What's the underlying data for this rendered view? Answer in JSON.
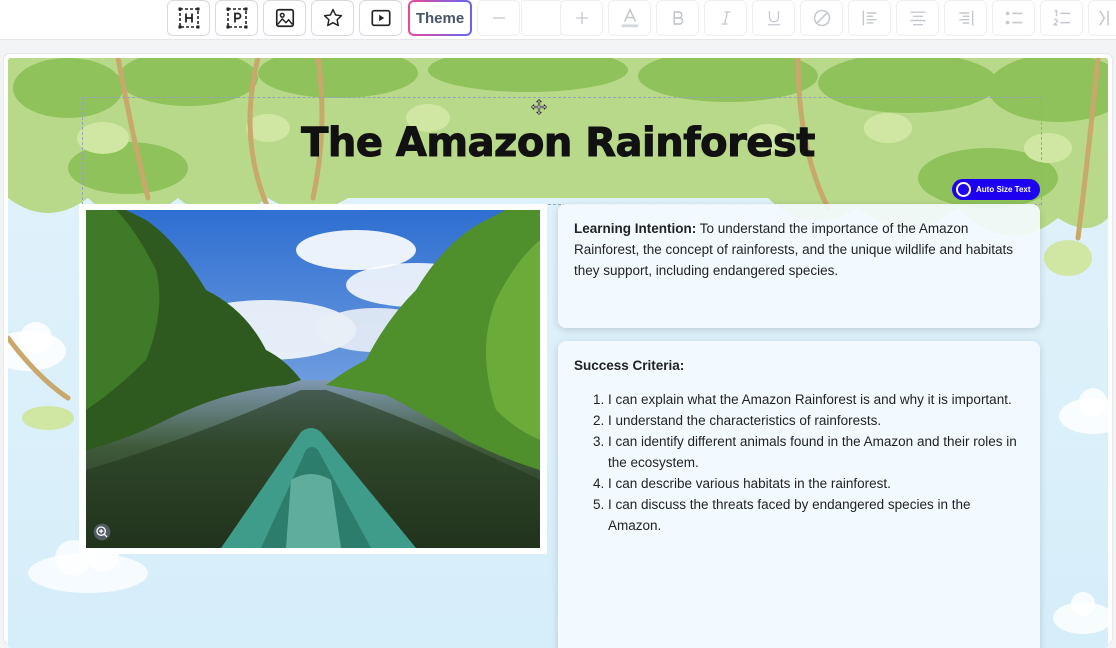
{
  "toolbar": {
    "icons": [
      "heading-icon",
      "paragraph-icon",
      "image-icon",
      "star-icon",
      "video-icon"
    ],
    "theme_label": "Theme",
    "font_size_value": ""
  },
  "slide": {
    "title": "The Amazon Rainforest",
    "auto_size_label": "Auto Size Text",
    "learning_intention_label": "Learning Intention:",
    "learning_intention_text": " To understand the importance of the Amazon Rainforest, the concept of rainforests, and the unique wildlife and habitats they support, including endangered species.",
    "success_criteria_label": "Success Criteria:",
    "success_criteria": [
      "I can explain what the Amazon Rainforest is and why it is important.",
      "I understand the characteristics of rainforests.",
      "I can identify different animals found in the Amazon and their roles in the ecosystem.",
      "I can describe various habitats in the rainforest.",
      "I can discuss the threats faced by endangered species in the Amazon."
    ]
  },
  "colors": {
    "accent": "#1d00f0",
    "theme_gradient_start": "#ec4899",
    "theme_gradient_end": "#6366f1"
  }
}
